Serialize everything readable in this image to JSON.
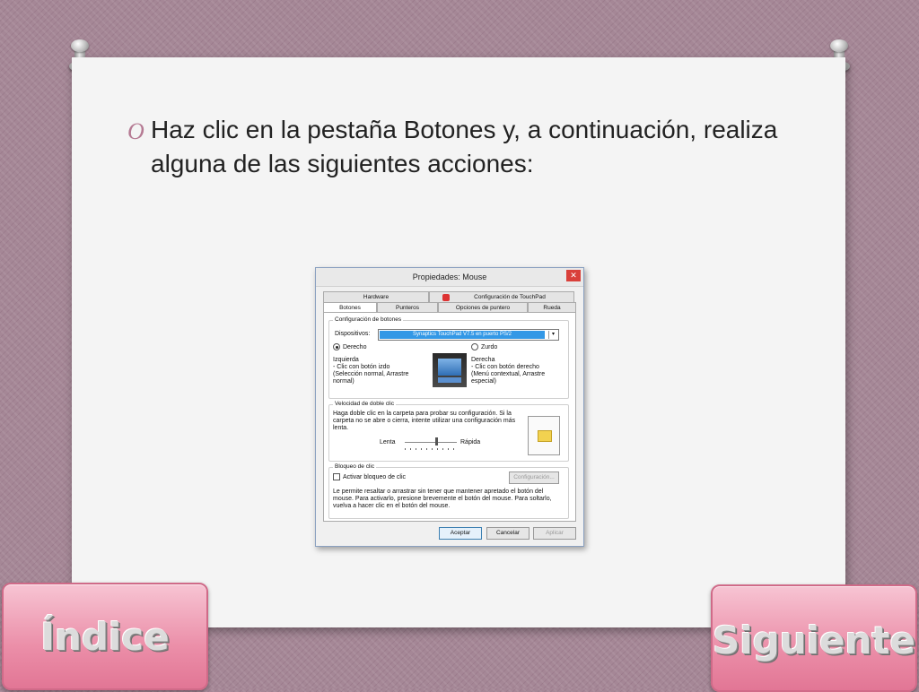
{
  "slide": {
    "bullet_marker": "O",
    "text_before": "Haz clic en la pestaña ",
    "text_bold": "Botones",
    "text_after": " y, a continuación, realiza alguna de las siguientes acciones:"
  },
  "dialog": {
    "title": "Propiedades: Mouse",
    "close_glyph": "✕",
    "tabs_row1": [
      "Hardware",
      "Configuración de TouchPad"
    ],
    "tabs_row2": [
      "Botones",
      "Punteros",
      "Opciones de puntero",
      "Rueda"
    ],
    "button_config": {
      "title": "Configuración de botones",
      "devices_label": "Dispositivos:",
      "devices_value": "Synaptics TouchPad V7.5 en puerto PS/2",
      "dropdown_glyph": "▾",
      "radio_right": "Derecho",
      "radio_left": "Zurdo",
      "left_desc": [
        "Izquierda",
        " - Clic con botón izdo",
        "(Selección normal, Arrastre",
        "normal)"
      ],
      "right_desc": [
        "Derecha",
        " - Clic con botón derecho",
        "(Menú contextual, Arrastre",
        "especial)"
      ]
    },
    "double_click": {
      "title": "Velocidad de doble clic",
      "description": "Haga doble clic en la carpeta para probar su configuración. Si la carpeta no se abre o cierra, intente utilizar una configuración más lenta.",
      "slow_label": "Lenta",
      "fast_label": "Rápida",
      "speed_level": 0.62
    },
    "click_lock": {
      "title": "Bloqueo de clic",
      "checkbox_label": "Activar bloqueo de clic",
      "checked": false,
      "settings_button": "Configuración...",
      "description": "Le permite resaltar o arrastrar sin tener que mantener apretado el botón del mouse. Para activarlo, presione brevemente el botón del mouse. Para soltarlo, vuelva a hacer clic en el botón del mouse."
    },
    "buttons": {
      "ok": "Aceptar",
      "cancel": "Cancelar",
      "apply": "Aplicar"
    }
  },
  "nav": {
    "index_label": "Índice",
    "next_label": "Siguiente"
  }
}
